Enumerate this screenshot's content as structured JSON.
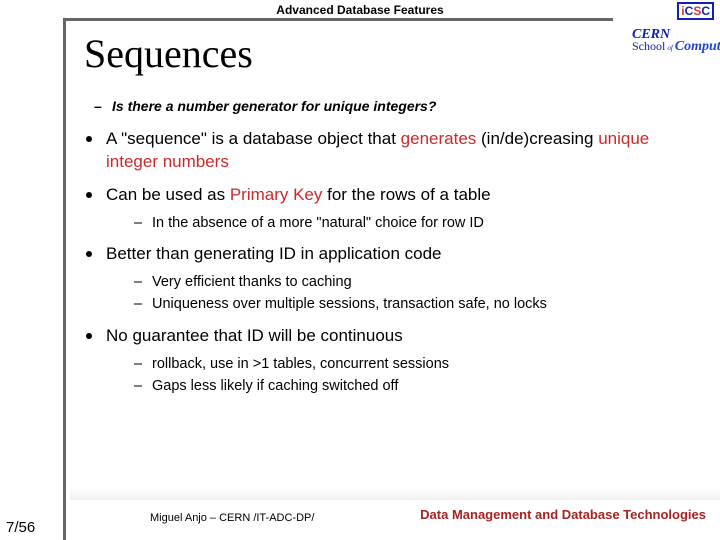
{
  "header": {
    "label": "Advanced Database Features",
    "title": "Sequences"
  },
  "logo": {
    "line1": "CERN",
    "school": "School",
    "of": "of",
    "computing": "Computing",
    "badge_i": "i",
    "badge_c": "C",
    "badge_s": "S",
    "badge_c2": "C"
  },
  "question": "Is there a number generator for unique integers?",
  "b1": {
    "pre": "A \"sequence\" is a database object that ",
    "hl1": "generates",
    "mid": " (in/de)creasing ",
    "hl2": "unique integer numbers"
  },
  "b2": {
    "pre": "Can be used as ",
    "hl": "Primary Key",
    "post": " for the rows of a table",
    "s1": "In the absence of a more \"natural\" choice for row ID"
  },
  "b3": {
    "text": "Better than generating ID in application code",
    "s1": "Very efficient thanks to caching",
    "s2": "Uniqueness over multiple sessions, transaction safe, no locks"
  },
  "b4": {
    "text": "No guarantee that ID will be continuous",
    "s1": "rollback, use in >1 tables, concurrent sessions",
    "s2": "Gaps less likely if caching switched off"
  },
  "footer": {
    "author": "Miguel Anjo – CERN /IT-ADC-DP/",
    "topic": "Data Management and Database Technologies",
    "pagenum": "7/56"
  }
}
